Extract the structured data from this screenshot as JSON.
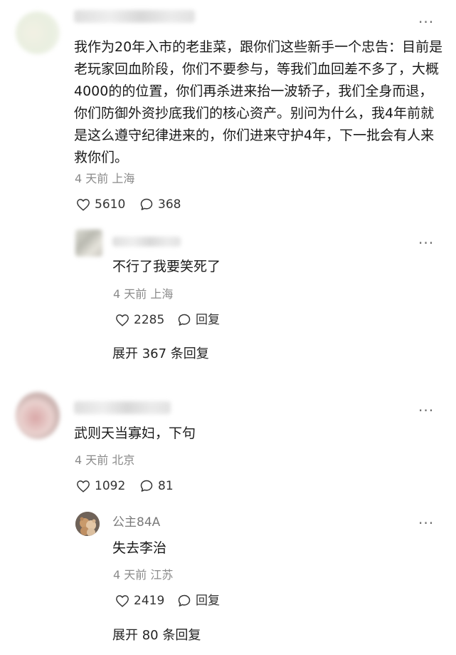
{
  "comments": [
    {
      "text": "我作为20年入市的老韭菜，跟你们这些新手一个忠告：目前是老玩家回血阶段，你们不要参与，等我们血回差不多了，大概4000的的位置，你们再杀进来抬一波轿子，我们全身而退，你们防御外资抄底我们的核心资产。别问为什么，我4年前就是这么遵守纪律进来的，你们进来守护4年，下一批会有人来救你们。",
      "meta": "4 天前 上海",
      "likes": "5610",
      "replies": "368",
      "reply": {
        "text": "不行了我要笑死了",
        "meta": "4 天前 上海",
        "likes": "2285",
        "reply_label": "回复"
      },
      "expand": "展开 367 条回复"
    },
    {
      "text": "武则天当寡妇，下句",
      "meta": "4 天前 北京",
      "likes": "1092",
      "replies": "81",
      "reply": {
        "username": "公主84A",
        "text": "失去李治",
        "meta": "4 天前 江苏",
        "likes": "2419",
        "reply_label": "回复"
      },
      "expand": "展开 80 条回复"
    }
  ],
  "more_icon": "more-dots-icon",
  "like_icon": "heart-outline-icon",
  "comment_icon": "speech-bubble-icon"
}
